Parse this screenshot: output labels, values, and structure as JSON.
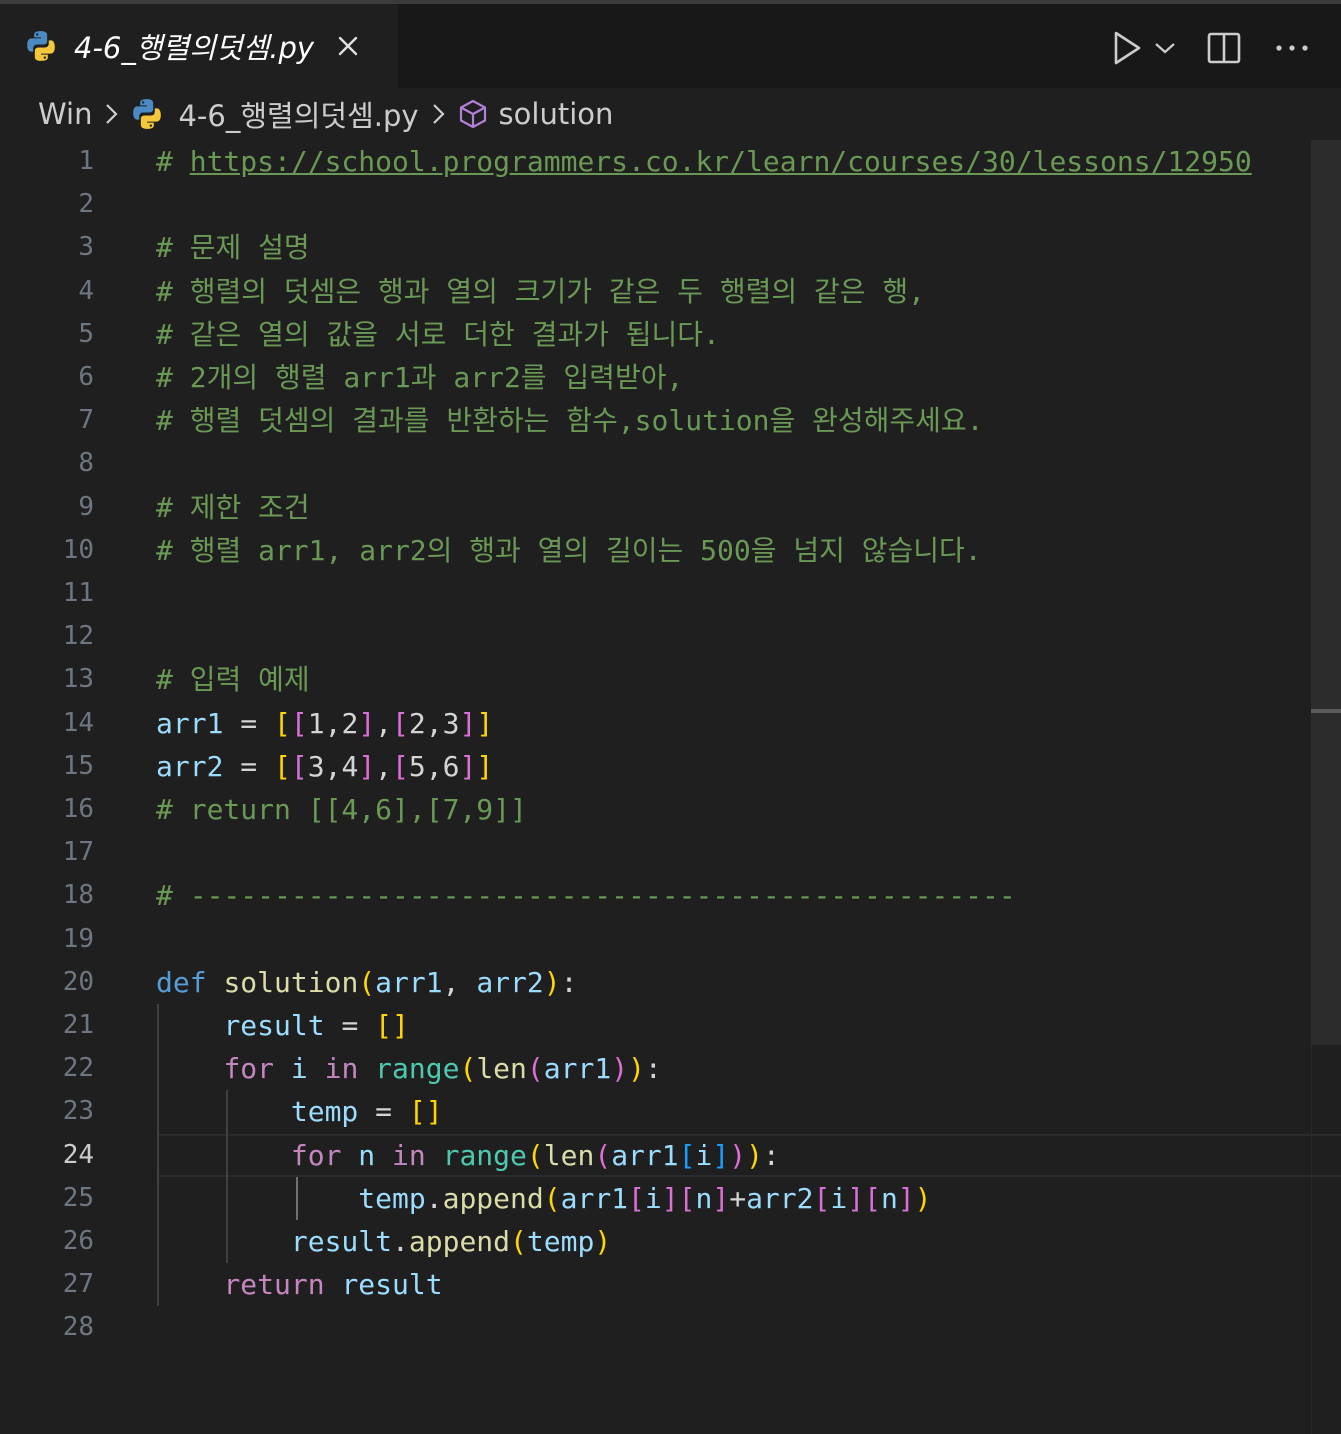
{
  "tab": {
    "title": "4-6_행렬의덧셈.py"
  },
  "breadcrumb": {
    "folder": "Win",
    "file": "4-6_행렬의덧셈.py",
    "symbol": "solution"
  },
  "icons": {
    "file_icon": "python-icon",
    "close": "close-icon",
    "run": "play-icon",
    "run_menu": "chevron-down-icon",
    "split": "split-editor-icon",
    "more": "more-actions-icon",
    "symbol": "cube-icon"
  },
  "editor": {
    "active_line": 24,
    "lines": [
      [
        {
          "t": "# ",
          "k": "com"
        },
        {
          "t": "https://school.programmers.co.kr/learn/courses/30/lessons/12950",
          "k": "link"
        }
      ],
      [],
      [
        {
          "t": "# 문제 설명",
          "k": "com"
        }
      ],
      [
        {
          "t": "# 행렬의 덧셈은 행과 열의 크기가 같은 두 행렬의 같은 행,",
          "k": "com"
        }
      ],
      [
        {
          "t": "# 같은 열의 값을 서로 더한 결과가 됩니다.",
          "k": "com"
        }
      ],
      [
        {
          "t": "# 2개의 행렬 arr1과 arr2를 입력받아,",
          "k": "com"
        }
      ],
      [
        {
          "t": "# 행렬 덧셈의 결과를 반환하는 함수,solution을 완성해주세요.",
          "k": "com"
        }
      ],
      [],
      [
        {
          "t": "# 제한 조건",
          "k": "com"
        }
      ],
      [
        {
          "t": "# 행렬 arr1, arr2의 행과 열의 길이는 500을 넘지 않습니다.",
          "k": "com"
        }
      ],
      [],
      [],
      [
        {
          "t": "# 입력 예제",
          "k": "com"
        }
      ],
      [
        {
          "t": "arr1",
          "k": "var"
        },
        {
          "t": " = ",
          "k": "op"
        },
        {
          "t": "[",
          "k": "b1"
        },
        {
          "t": "[",
          "k": "b2"
        },
        {
          "t": "1,2",
          "k": "op"
        },
        {
          "t": "]",
          "k": "b2"
        },
        {
          "t": ",",
          "k": "op"
        },
        {
          "t": "[",
          "k": "b2"
        },
        {
          "t": "2,3",
          "k": "op"
        },
        {
          "t": "]",
          "k": "b2"
        },
        {
          "t": "]",
          "k": "b1"
        }
      ],
      [
        {
          "t": "arr2",
          "k": "var"
        },
        {
          "t": " = ",
          "k": "op"
        },
        {
          "t": "[",
          "k": "b1"
        },
        {
          "t": "[",
          "k": "b2"
        },
        {
          "t": "3,4",
          "k": "op"
        },
        {
          "t": "]",
          "k": "b2"
        },
        {
          "t": ",",
          "k": "op"
        },
        {
          "t": "[",
          "k": "b2"
        },
        {
          "t": "5,6",
          "k": "op"
        },
        {
          "t": "]",
          "k": "b2"
        },
        {
          "t": "]",
          "k": "b1"
        }
      ],
      [
        {
          "t": "# return [[4,6],[7,9]]",
          "k": "com"
        }
      ],
      [],
      [
        {
          "t": "# -------------------------------------------------",
          "k": "com"
        }
      ],
      [],
      [
        {
          "t": "def",
          "k": "def"
        },
        {
          "t": " ",
          "k": "op"
        },
        {
          "t": "solution",
          "k": "fn"
        },
        {
          "t": "(",
          "k": "b1"
        },
        {
          "t": "arr1",
          "k": "var"
        },
        {
          "t": ", ",
          "k": "op"
        },
        {
          "t": "arr2",
          "k": "var"
        },
        {
          "t": ")",
          "k": "b1"
        },
        {
          "t": ":",
          "k": "op"
        }
      ],
      [
        {
          "t": "    ",
          "k": "op"
        },
        {
          "t": "result",
          "k": "var"
        },
        {
          "t": " = ",
          "k": "op"
        },
        {
          "t": "[]",
          "k": "b1"
        }
      ],
      [
        {
          "t": "    ",
          "k": "op"
        },
        {
          "t": "for",
          "k": "kw"
        },
        {
          "t": " ",
          "k": "op"
        },
        {
          "t": "i",
          "k": "var"
        },
        {
          "t": " ",
          "k": "op"
        },
        {
          "t": "in",
          "k": "kw"
        },
        {
          "t": " ",
          "k": "op"
        },
        {
          "t": "range",
          "k": "bi"
        },
        {
          "t": "(",
          "k": "b1"
        },
        {
          "t": "len",
          "k": "fn"
        },
        {
          "t": "(",
          "k": "b2"
        },
        {
          "t": "arr1",
          "k": "var"
        },
        {
          "t": ")",
          "k": "b2"
        },
        {
          "t": ")",
          "k": "b1"
        },
        {
          "t": ":",
          "k": "op"
        }
      ],
      [
        {
          "t": "        ",
          "k": "op"
        },
        {
          "t": "temp",
          "k": "var"
        },
        {
          "t": " = ",
          "k": "op"
        },
        {
          "t": "[]",
          "k": "b1"
        }
      ],
      [
        {
          "t": "        ",
          "k": "op"
        },
        {
          "t": "for",
          "k": "kw"
        },
        {
          "t": " ",
          "k": "op"
        },
        {
          "t": "n",
          "k": "var"
        },
        {
          "t": " ",
          "k": "op"
        },
        {
          "t": "in",
          "k": "kw"
        },
        {
          "t": " ",
          "k": "op"
        },
        {
          "t": "range",
          "k": "bi"
        },
        {
          "t": "(",
          "k": "b1"
        },
        {
          "t": "len",
          "k": "fn"
        },
        {
          "t": "(",
          "k": "b2"
        },
        {
          "t": "arr1",
          "k": "var"
        },
        {
          "t": "[",
          "k": "b3"
        },
        {
          "t": "i",
          "k": "var"
        },
        {
          "t": "]",
          "k": "b3"
        },
        {
          "t": ")",
          "k": "b2"
        },
        {
          "t": ")",
          "k": "b1"
        },
        {
          "t": ":",
          "k": "op"
        }
      ],
      [
        {
          "t": "            ",
          "k": "op"
        },
        {
          "t": "temp",
          "k": "var"
        },
        {
          "t": ".",
          "k": "op"
        },
        {
          "t": "append",
          "k": "fn"
        },
        {
          "t": "(",
          "k": "b1"
        },
        {
          "t": "arr1",
          "k": "var"
        },
        {
          "t": "[",
          "k": "b2"
        },
        {
          "t": "i",
          "k": "var"
        },
        {
          "t": "]",
          "k": "b2"
        },
        {
          "t": "[",
          "k": "b2"
        },
        {
          "t": "n",
          "k": "var"
        },
        {
          "t": "]",
          "k": "b2"
        },
        {
          "t": "+",
          "k": "op"
        },
        {
          "t": "arr2",
          "k": "var"
        },
        {
          "t": "[",
          "k": "b2"
        },
        {
          "t": "i",
          "k": "var"
        },
        {
          "t": "]",
          "k": "b2"
        },
        {
          "t": "[",
          "k": "b2"
        },
        {
          "t": "n",
          "k": "var"
        },
        {
          "t": "]",
          "k": "b2"
        },
        {
          "t": ")",
          "k": "b1"
        }
      ],
      [
        {
          "t": "        ",
          "k": "op"
        },
        {
          "t": "result",
          "k": "var"
        },
        {
          "t": ".",
          "k": "op"
        },
        {
          "t": "append",
          "k": "fn"
        },
        {
          "t": "(",
          "k": "b1"
        },
        {
          "t": "temp",
          "k": "var"
        },
        {
          "t": ")",
          "k": "b1"
        }
      ],
      [
        {
          "t": "    ",
          "k": "op"
        },
        {
          "t": "return",
          "k": "kw"
        },
        {
          "t": " ",
          "k": "op"
        },
        {
          "t": "result",
          "k": "var"
        }
      ],
      []
    ]
  }
}
